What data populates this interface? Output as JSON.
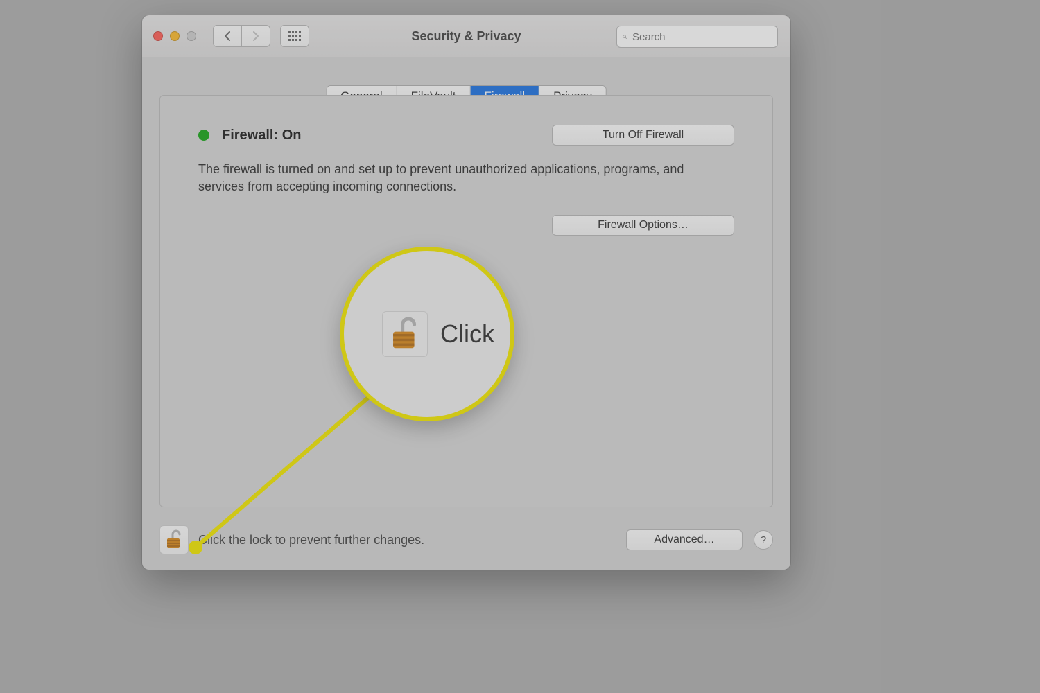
{
  "window": {
    "title": "Security & Privacy"
  },
  "toolbar": {
    "search_placeholder": "Search"
  },
  "tabs": {
    "general": "General",
    "filevault": "FileVault",
    "firewall": "Firewall",
    "privacy": "Privacy",
    "active": "firewall"
  },
  "firewall": {
    "status_label": "Firewall: On",
    "status_color": "#1aa81a",
    "turn_off_label": "Turn Off Firewall",
    "description": "The firewall is turned on and set up to prevent unauthorized applications, programs, and services from accepting incoming connections.",
    "options_label": "Firewall Options…"
  },
  "footer": {
    "lock_hint": "Click the lock to prevent further changes.",
    "advanced_label": "Advanced…",
    "help_label": "?"
  },
  "callout": {
    "visible_text": "Click"
  }
}
